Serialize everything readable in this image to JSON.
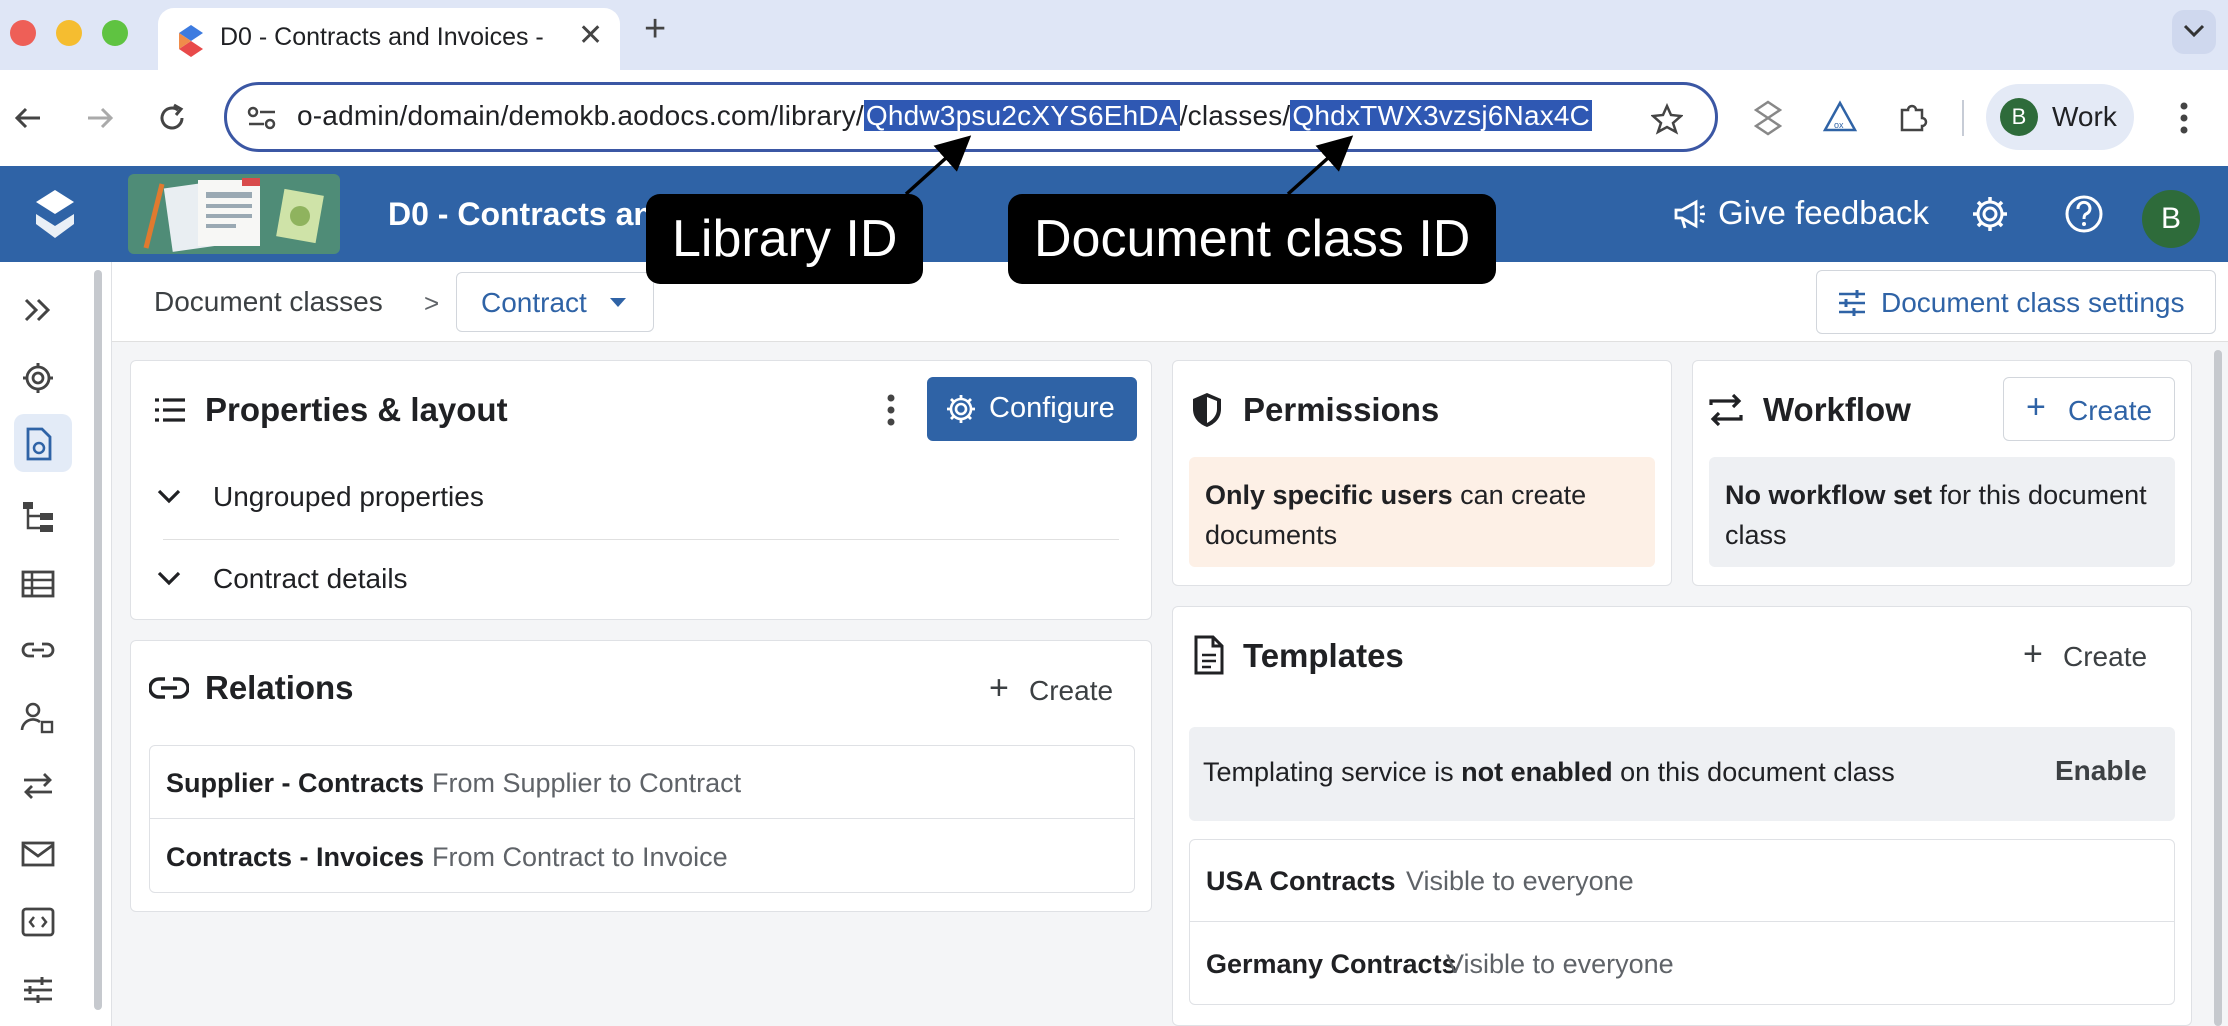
{
  "browser": {
    "tab_title": "D0 - Contracts and Invoices -",
    "url_prefix": "o-admin/domain/demokb.aodocs.com/library/",
    "library_id": "Qhdw3psu2cXYS6EhDA",
    "url_mid": "/classes/",
    "class_id": "QhdxTWX3vzsj6Nax4C",
    "profile": {
      "initial": "B",
      "label": "Work"
    }
  },
  "app": {
    "title": "D0 - Contracts and",
    "feedback_label": "Give feedback",
    "user_initial": "B"
  },
  "annotations": {
    "library_id_label": "Library ID",
    "class_id_label": "Document class ID"
  },
  "breadcrumb": {
    "root": "Document classes",
    "separator": ">",
    "current": "Contract",
    "settings_label": "Document class settings"
  },
  "properties": {
    "title": "Properties & layout",
    "configure_label": "Configure",
    "groups": [
      "Ungrouped properties",
      "Contract details"
    ]
  },
  "relations": {
    "title": "Relations",
    "create_label": "Create",
    "rows": [
      {
        "name": "Supplier - Contracts",
        "desc": "From Supplier to Contract"
      },
      {
        "name": "Contracts - Invoices",
        "desc": "From Contract to Invoice"
      }
    ]
  },
  "permissions": {
    "title": "Permissions",
    "bold": "Only specific users",
    "rest": " can create documents"
  },
  "workflow": {
    "title": "Workflow",
    "create_label": "Create",
    "bold": "No workflow set",
    "rest": " for this document class"
  },
  "templates": {
    "title": "Templates",
    "create_label": "Create",
    "service_pre": "Templating service is ",
    "service_bold": "not enabled",
    "service_post": " on this document class",
    "enable_label": "Enable",
    "rows": [
      {
        "name": "USA Contracts",
        "desc": "Visible to everyone"
      },
      {
        "name": "Germany Contracts",
        "desc": "Visible to everyone"
      }
    ]
  },
  "colors": {
    "brand": "#2f63a6",
    "selection": "#2f58b3",
    "permission_bg": "#fdf0e6",
    "info_bg": "#eef0f3"
  }
}
